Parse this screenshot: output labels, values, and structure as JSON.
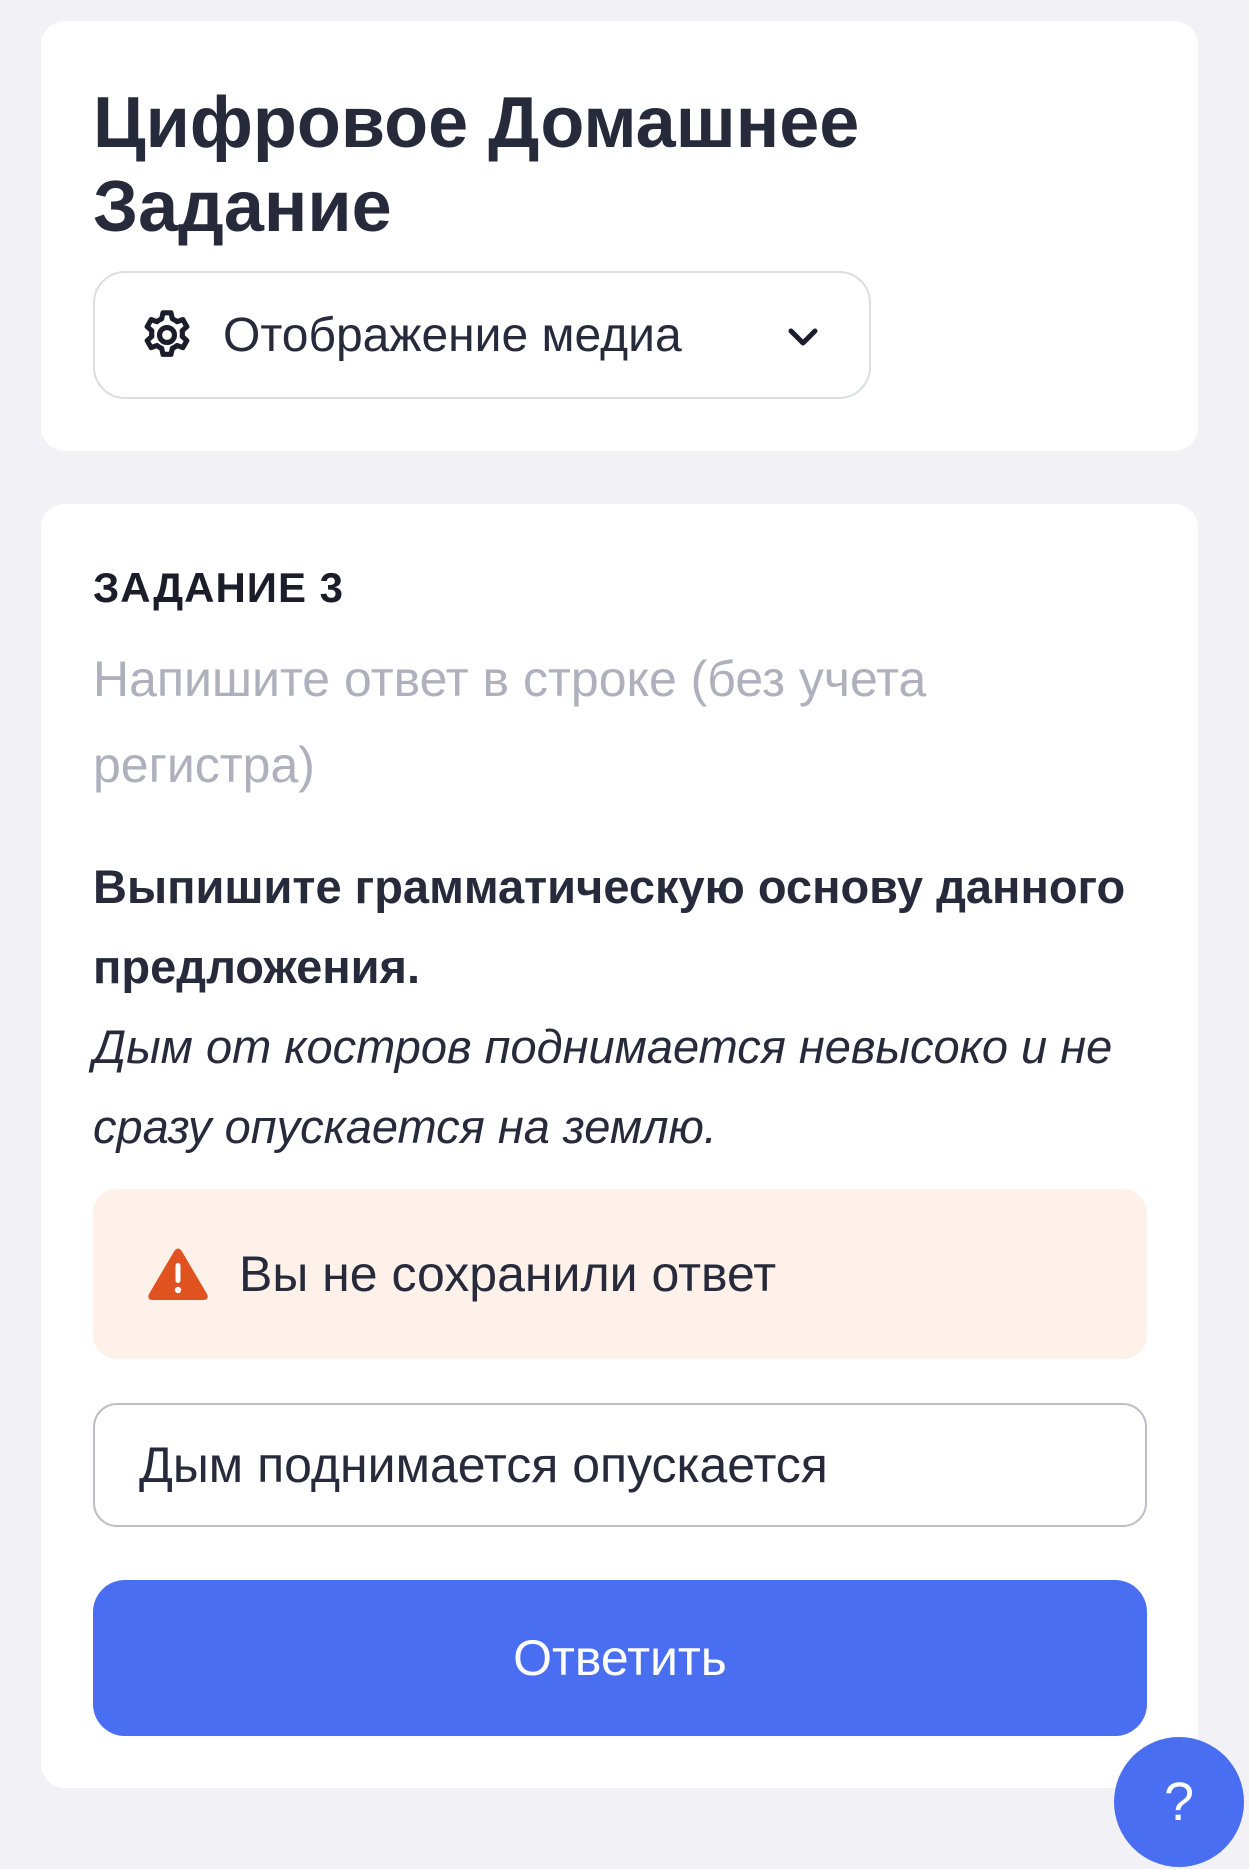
{
  "header": {
    "title": "Цифровое Домашнее Задание",
    "media_toggle": {
      "label": "Отображение медиа",
      "icon": "gear-icon",
      "chevron": "chevron-down-icon"
    }
  },
  "task": {
    "number": "ЗАДАНИЕ 3",
    "hint": "Напишите ответ в строке (без учета регистра)",
    "question": "Выпишите грамматическую основу данного предложения.",
    "sentence": "Дым от костров поднимается невысоко и не сразу опускается на землю.",
    "warning": {
      "icon": "warning-icon",
      "text": "Вы не сохранили ответ",
      "color": "#e0521f",
      "background": "#fdf1ea"
    },
    "answer_value": "Дым поднимается опускается",
    "submit_label": "Ответить"
  },
  "help": {
    "label": "?"
  },
  "colors": {
    "accent": "#4a6ef2",
    "background": "#f2f2f6",
    "card": "#ffffff",
    "text": "#262a3b",
    "hint_text": "#aeb1bd"
  }
}
